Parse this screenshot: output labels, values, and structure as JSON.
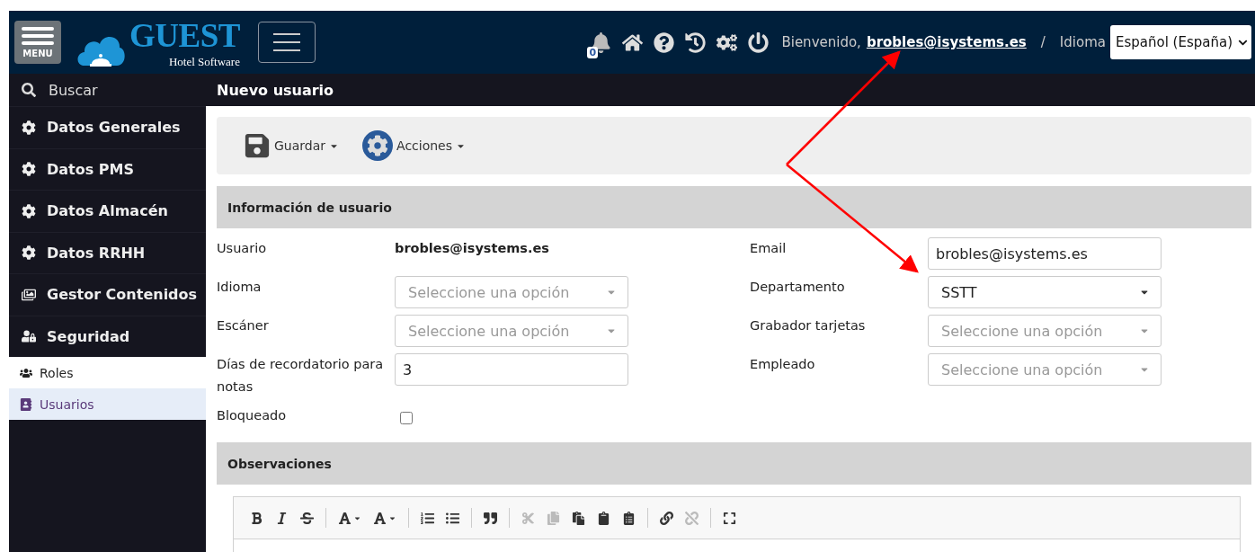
{
  "header": {
    "logo": {
      "title": "GUEST",
      "subtitle": "Hotel Software"
    },
    "menu_label": "MENU",
    "notifications": "0",
    "welcome": "Bienvenido,",
    "user": "brobles@isystems.es",
    "separator": "/",
    "language_label": "Idioma",
    "language": "Español (España)"
  },
  "sidebar": {
    "search": "Buscar",
    "items": [
      {
        "kind": "gear",
        "label": "Datos Generales",
        "selected": false
      },
      {
        "kind": "gear",
        "label": "Datos PMS",
        "selected": false
      },
      {
        "kind": "gear",
        "label": "Datos Almacén",
        "selected": false
      },
      {
        "kind": "gear",
        "label": "Datos RRHH",
        "selected": false
      },
      {
        "kind": "images",
        "label": "Gestor Contenidos",
        "selected": false
      },
      {
        "kind": "user-lock",
        "label": "Seguridad",
        "selected": false,
        "expanded": true,
        "children": [
          {
            "kind": "users",
            "label": "Roles",
            "selected": false
          },
          {
            "kind": "address",
            "label": "Usuarios",
            "selected": true
          }
        ]
      }
    ]
  },
  "page": {
    "title": "Nuevo usuario",
    "toolbar": [
      {
        "kind": "save",
        "label": "Guardar"
      },
      {
        "kind": "actions",
        "label": "Acciones"
      }
    ],
    "section": "Información de usuario",
    "left_fields": [
      {
        "kind": "text",
        "label": "Usuario",
        "value": "brobles@isystems.es"
      },
      {
        "kind": "select",
        "label": "Idioma",
        "placeholder": "Seleccione una opción"
      },
      {
        "kind": "select",
        "label": "Escáner",
        "placeholder": "Seleccione una opción"
      },
      {
        "kind": "input",
        "label": "Días de recordatorio para notas",
        "value": "3"
      },
      {
        "kind": "checkbox",
        "label": "Bloqueado",
        "checked": false
      }
    ],
    "right_fields": [
      {
        "kind": "input",
        "label": "Email",
        "value": "brobles@isystems.es"
      },
      {
        "kind": "select",
        "label": "Departamento",
        "value": "SSTT"
      },
      {
        "kind": "select",
        "label": "Grabador tarjetas",
        "placeholder": "Seleccione una opción"
      },
      {
        "kind": "select",
        "label": "Empleado",
        "placeholder": "Seleccione una opción"
      }
    ],
    "notes_section": "Observaciones",
    "editor_toolbar": [
      {
        "kind": "bold",
        "disabled": false
      },
      {
        "kind": "italic",
        "disabled": false
      },
      {
        "kind": "strike",
        "disabled": false
      },
      {
        "kind": "sep"
      },
      {
        "kind": "text-color",
        "disabled": false
      },
      {
        "kind": "bg-color",
        "disabled": false
      },
      {
        "kind": "sep"
      },
      {
        "kind": "ordered-list",
        "disabled": false
      },
      {
        "kind": "bullet-list",
        "disabled": false
      },
      {
        "kind": "sep"
      },
      {
        "kind": "quote",
        "disabled": false
      },
      {
        "kind": "sep"
      },
      {
        "kind": "cut",
        "disabled": true
      },
      {
        "kind": "copy",
        "disabled": true
      },
      {
        "kind": "paste",
        "disabled": false
      },
      {
        "kind": "paste-text",
        "disabled": false
      },
      {
        "kind": "paste-word",
        "disabled": false
      },
      {
        "kind": "sep"
      },
      {
        "kind": "link",
        "disabled": false
      },
      {
        "kind": "unlink",
        "disabled": true
      },
      {
        "kind": "sep"
      },
      {
        "kind": "maximize",
        "disabled": false
      }
    ]
  }
}
